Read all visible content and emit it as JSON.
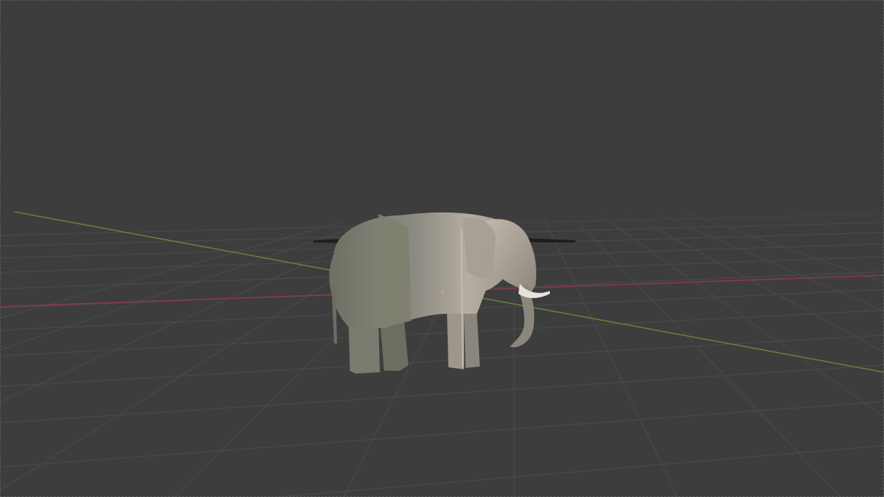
{
  "viewport": {
    "mode": "3D viewport",
    "background_color": "#3d3d3d",
    "grid_color": "#4a4a4a",
    "x_axis_color": "#8c3a46",
    "y_axis_color": "#6b7f3a"
  },
  "scene": {
    "object": "elephant-model",
    "model_tint": "#8e8c82"
  }
}
